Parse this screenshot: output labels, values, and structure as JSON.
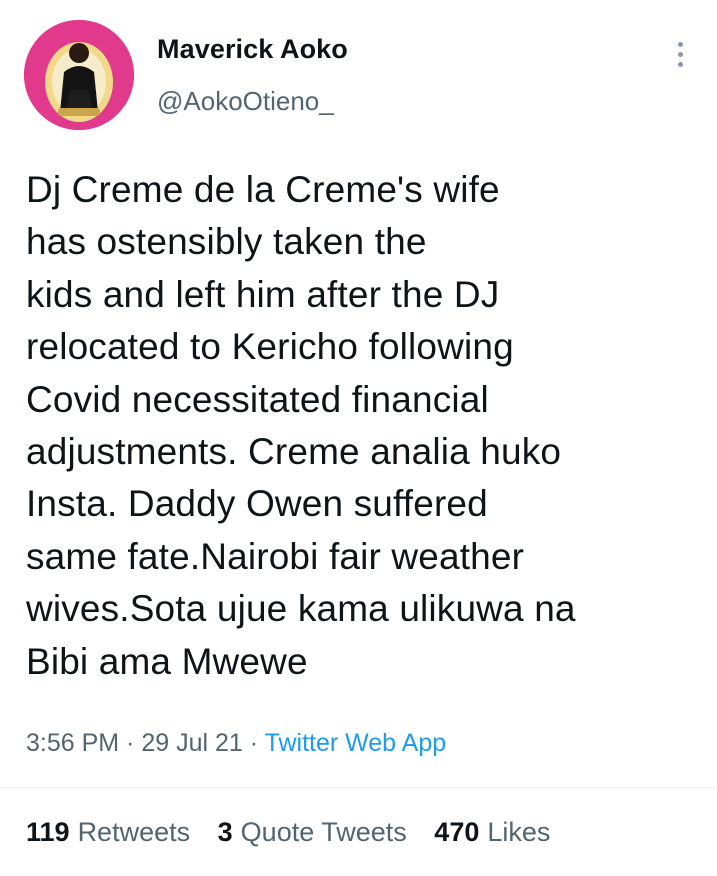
{
  "author": {
    "display_name": "Maverick Aoko",
    "handle": "@AokoOtieno_"
  },
  "icons": {
    "avatar": "avatar-photo",
    "more": "more-options-icon"
  },
  "tweet": {
    "lines": [
      "Dj Creme de la Creme's wife",
      "has ostensibly taken the",
      "kids and left him after the DJ",
      "relocated to Kericho following",
      "Covid necessitated financial",
      "adjustments. Creme analia huko",
      "Insta. Daddy Owen suffered",
      "same fate.Nairobi fair weather",
      "wives.Sota ujue kama ulikuwa na",
      "Bibi ama Mwewe"
    ]
  },
  "meta": {
    "time": "3:56 PM",
    "separator": " · ",
    "date": "29 Jul 21",
    "source": "Twitter Web App"
  },
  "stats": {
    "retweets_count": "119",
    "retweets_label": "Retweets",
    "quotes_count": "3",
    "quotes_label": "Quote Tweets",
    "likes_count": "470",
    "likes_label": "Likes"
  },
  "colors": {
    "text": "#0f1419",
    "secondary": "#536471",
    "link": "#1d9bf0",
    "avatar_background": "#e13a8d"
  }
}
